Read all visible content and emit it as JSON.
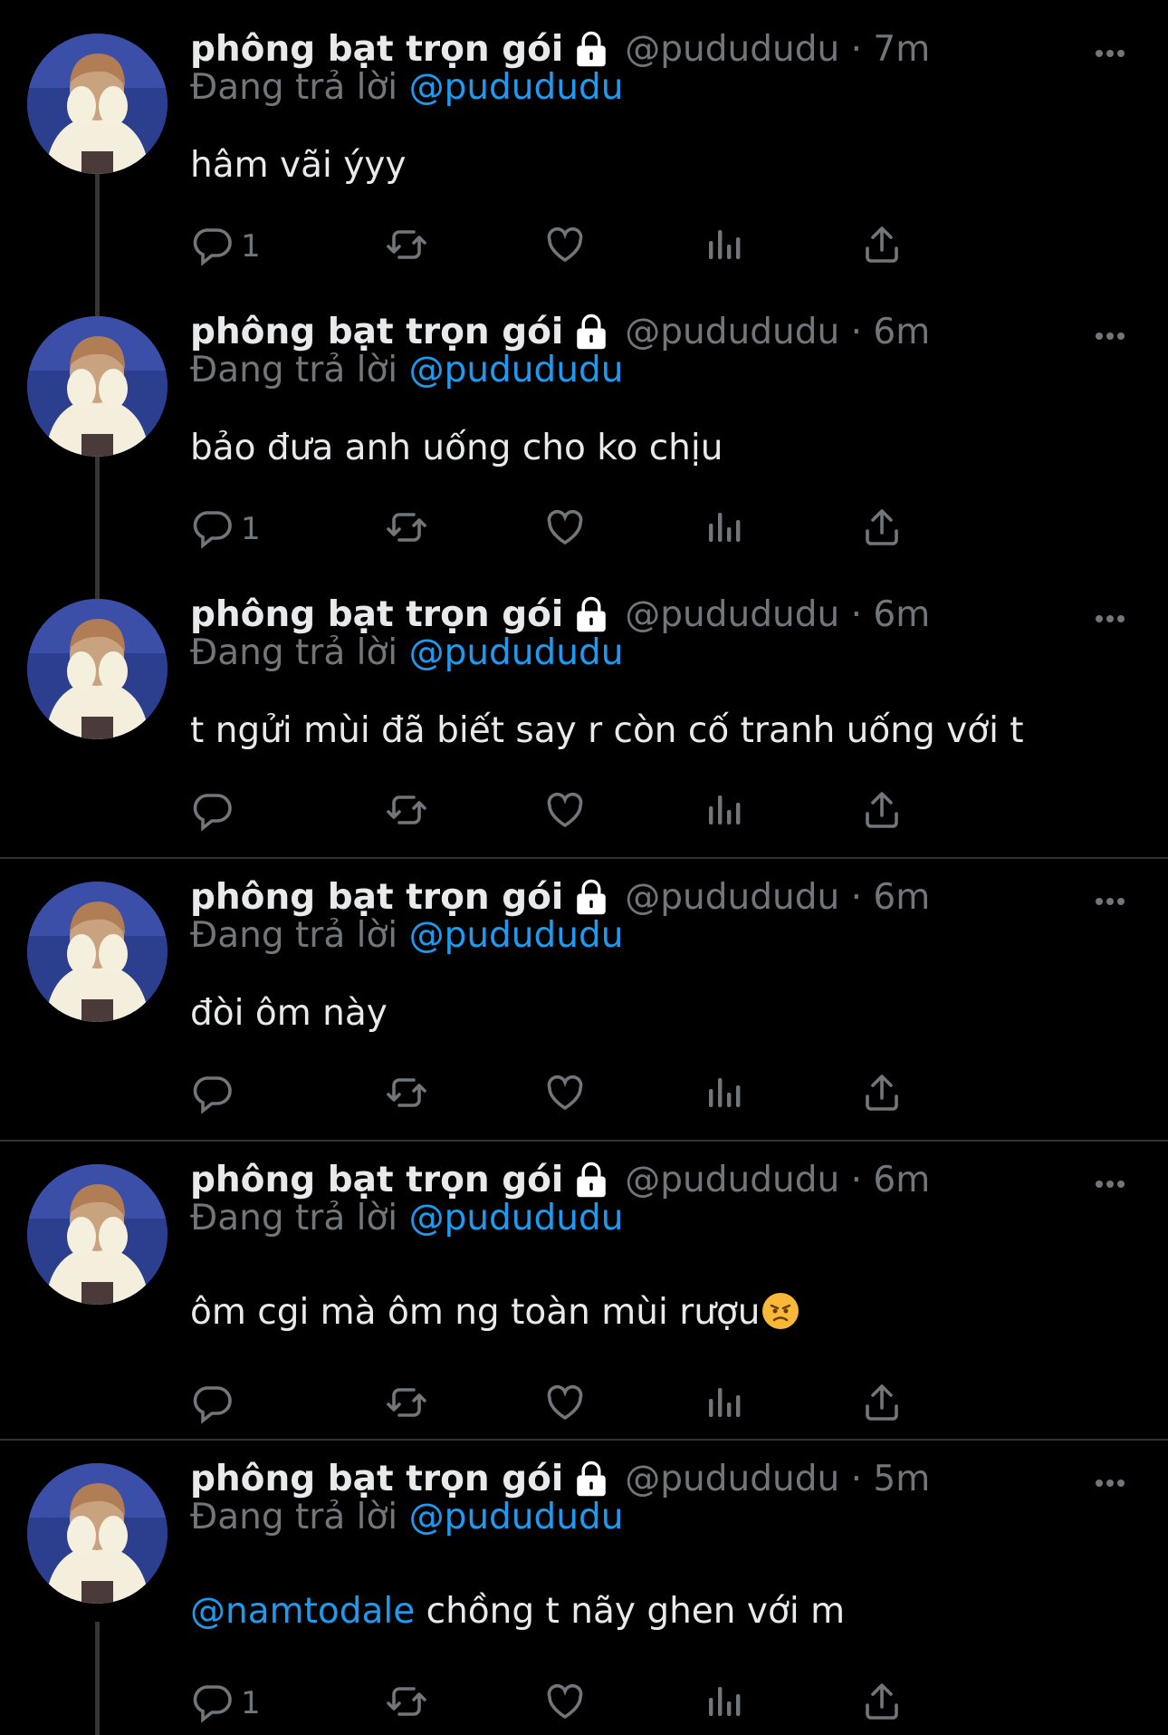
{
  "tweets": [
    {
      "name": "phông bạt trọn gói",
      "handle": "@pudududu",
      "time": "7m",
      "reply_prefix": "Đang trả lời",
      "reply_to": "@pudududu",
      "text": "hâm vãi ýyy",
      "reply_count": "1"
    },
    {
      "name": "phông bạt trọn gói",
      "handle": "@pudududu",
      "time": "6m",
      "reply_prefix": "Đang trả lời",
      "reply_to": "@pudududu",
      "text": "bảo đưa anh uống cho ko chịu",
      "reply_count": "1"
    },
    {
      "name": "phông bạt trọn gói",
      "handle": "@pudududu",
      "time": "6m",
      "reply_prefix": "Đang trả lời",
      "reply_to": "@pudududu",
      "text": "t ngửi mùi đã biết say r còn cố tranh uống với t",
      "reply_count": ""
    },
    {
      "name": "phông bạt trọn gói",
      "handle": "@pudududu",
      "time": "6m",
      "reply_prefix": "Đang trả lời",
      "reply_to": "@pudududu",
      "text": "đòi ôm này",
      "reply_count": ""
    },
    {
      "name": "phông bạt trọn gói",
      "handle": "@pudududu",
      "time": "6m",
      "reply_prefix": "Đang trả lời",
      "reply_to": "@pudududu",
      "text": "ôm cgi mà ôm ng toàn mùi rượu",
      "emoji": "angry-face-emoji",
      "reply_count": ""
    },
    {
      "name": "phông bạt trọn gói",
      "handle": "@pudududu",
      "time": "5m",
      "reply_prefix": "Đang trả lời",
      "reply_to": "@pudududu",
      "mention": "@namtodale",
      "text": " chồng t nãy ghen với m",
      "reply_count": "1"
    }
  ],
  "icons": {
    "lock": "lock-icon",
    "more": "more-icon",
    "reply": "reply-icon",
    "retweet": "retweet-icon",
    "like": "like-icon",
    "views": "views-icon",
    "share": "share-icon"
  },
  "colors": {
    "background": "#000000",
    "text": "#e7e9ea",
    "muted": "#71767b",
    "accent": "#1d9bf0",
    "divider": "#2f3336"
  }
}
